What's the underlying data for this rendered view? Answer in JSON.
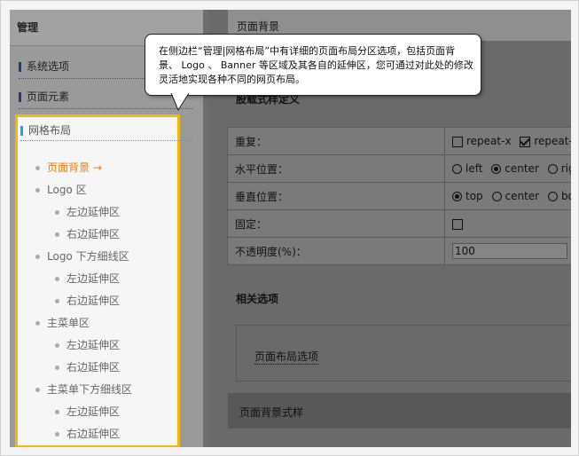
{
  "sidebar": {
    "header": "管理",
    "items": [
      {
        "label": "系统选项"
      },
      {
        "label": "页面元素"
      }
    ],
    "grid_section": {
      "title": "网格布局",
      "tree": [
        {
          "label": "页面背景",
          "arrow": "→",
          "active": true,
          "level": 0
        },
        {
          "label": "Logo 区",
          "level": 0
        },
        {
          "label": "左边延伸区",
          "level": 1
        },
        {
          "label": "右边延伸区",
          "level": 1
        },
        {
          "label": "Logo 下方细线区",
          "level": 0
        },
        {
          "label": "左边延伸区",
          "level": 1
        },
        {
          "label": "右边延伸区",
          "level": 1
        },
        {
          "label": "主菜单区",
          "level": 0
        },
        {
          "label": "左边延伸区",
          "level": 1
        },
        {
          "label": "右边延伸区",
          "level": 1
        },
        {
          "label": "主菜单下方细线区",
          "level": 0
        },
        {
          "label": "左边延伸区",
          "level": 1
        },
        {
          "label": "右边延伸区",
          "level": 1
        }
      ]
    },
    "highlight_color": "#f2b80c"
  },
  "main": {
    "tab_title": "页面背景",
    "section_title": "股载式样定义",
    "settings": {
      "repeat": {
        "label": "重复：",
        "options": [
          {
            "text": "repeat-x",
            "checked": false
          },
          {
            "text": "repeat-y",
            "checked": true
          }
        ]
      },
      "hpos": {
        "label": "水平位置：",
        "options": [
          {
            "text": "left",
            "selected": false
          },
          {
            "text": "center",
            "selected": true
          },
          {
            "text": "righ",
            "selected": false
          }
        ]
      },
      "vpos": {
        "label": "垂直位置：",
        "options": [
          {
            "text": "top",
            "selected": true
          },
          {
            "text": "center",
            "selected": false
          },
          {
            "text": "bot",
            "selected": false
          }
        ]
      },
      "fixed": {
        "label": "固定：",
        "checked": false
      },
      "opacity": {
        "label": "不透明度(%)：",
        "value": "100"
      }
    },
    "related_title": "相关选项",
    "related_link": "页面布局选项",
    "bottom_bar": "页面背景式样"
  },
  "callout": {
    "text": "在侧边栏“管理|网格布局”中有详细的页面布局分区选项，包括页面背景、 Logo 、 Banner 等区域及其各自的延伸区，您可通过对此处的修改灵活地实现各种不同的网页布局。"
  }
}
